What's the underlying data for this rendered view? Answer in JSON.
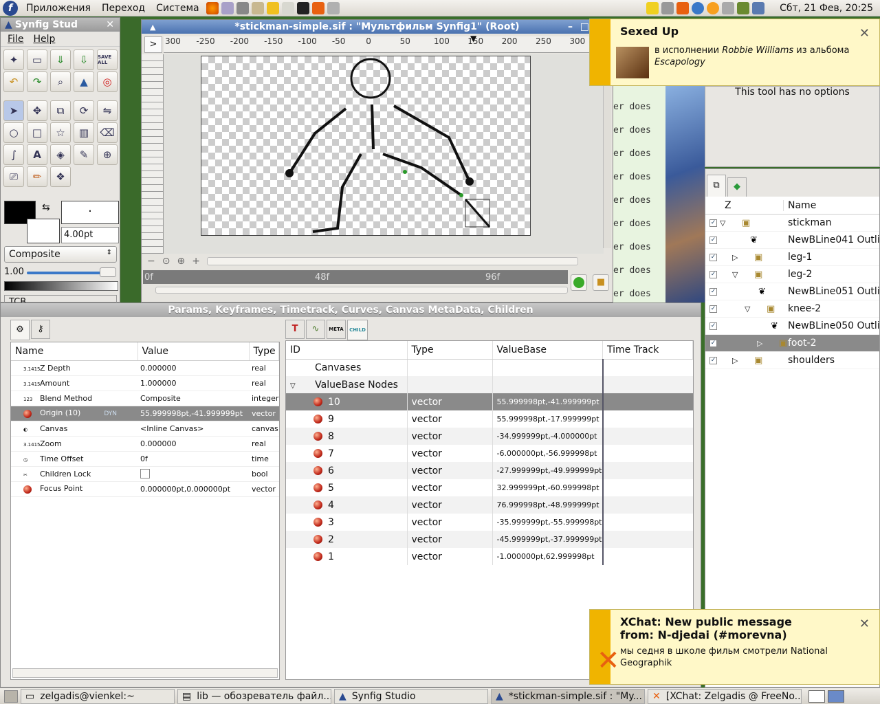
{
  "topbar": {
    "menus": [
      "Приложения",
      "Переход",
      "Система"
    ],
    "clock": "Сбт, 21 Фев, 20:25"
  },
  "toolbox": {
    "title": "Synfig Stud",
    "menu": [
      "File",
      "Help"
    ],
    "brush_size": "4.00pt",
    "blend": "Composite",
    "opacity": "1.00",
    "interp": "TCB"
  },
  "canvas": {
    "title": "*stickman-simple.sif : \"Мультфильм Synfig1\" (Root)",
    "hruler": [
      "300",
      "-250",
      "-200",
      "-150",
      "-100",
      "-50",
      "0",
      "50",
      "100",
      "150",
      "200",
      "250",
      "300"
    ],
    "timeline_marks": [
      "0f",
      "48f",
      "96f"
    ],
    "side_text": "er does"
  },
  "tool_options": {
    "text": "This tool has no options"
  },
  "params_panel": {
    "title": "Params, Keyframes, Timetrack, Curves, Canvas MetaData, Children",
    "columns": [
      "Name",
      "Value",
      "Type"
    ],
    "rows": [
      {
        "name": "Z Depth",
        "value": "0.000000",
        "type": "real"
      },
      {
        "name": "Amount",
        "value": "1.000000",
        "type": "real"
      },
      {
        "name": "Blend Method",
        "value": "Composite",
        "type": "integer"
      },
      {
        "name": "Origin (10)",
        "value": "55.999998pt,-41.999999pt",
        "type": "vector"
      },
      {
        "name": "Canvas",
        "value": "<Inline Canvas>",
        "type": "canvas"
      },
      {
        "name": "Zoom",
        "value": "0.000000",
        "type": "real"
      },
      {
        "name": "Time Offset",
        "value": "0f",
        "type": "time"
      },
      {
        "name": "Children Lock",
        "value": "",
        "type": "bool"
      },
      {
        "name": "Focus Point",
        "value": "0.000000pt,0.000000pt",
        "type": "vector"
      }
    ],
    "dyn": "DYN"
  },
  "children_panel": {
    "tab_meta": "META",
    "tab_child": "CHILD",
    "columns": [
      "ID",
      "Type",
      "ValueBase",
      "Time Track"
    ],
    "canvases": "Canvases",
    "valuebase_nodes": "ValueBase Nodes",
    "nodes": [
      {
        "id": "10",
        "type": "vector",
        "value": "55.999998pt,-41.999999pt"
      },
      {
        "id": "9",
        "type": "vector",
        "value": "55.999998pt,-17.999999pt"
      },
      {
        "id": "8",
        "type": "vector",
        "value": "-34.999999pt,-4.000000pt"
      },
      {
        "id": "7",
        "type": "vector",
        "value": "-6.000000pt,-56.999998pt"
      },
      {
        "id": "6",
        "type": "vector",
        "value": "-27.999999pt,-49.999999pt"
      },
      {
        "id": "5",
        "type": "vector",
        "value": "32.999999pt,-60.999998pt"
      },
      {
        "id": "4",
        "type": "vector",
        "value": "76.999998pt,-48.999999pt"
      },
      {
        "id": "3",
        "type": "vector",
        "value": "-35.999999pt,-55.999998pt"
      },
      {
        "id": "2",
        "type": "vector",
        "value": "-45.999999pt,-37.999999pt"
      },
      {
        "id": "1",
        "type": "vector",
        "value": "-1.000000pt,62.999998pt"
      }
    ]
  },
  "layers_panel": {
    "columns": [
      "Z",
      "Name"
    ],
    "layers": [
      {
        "name": "stickman",
        "indent": 0,
        "expander": "open",
        "kind": "group"
      },
      {
        "name": "NewBLine041 Outlin",
        "indent": 1,
        "expander": "",
        "kind": "outline"
      },
      {
        "name": "leg-1",
        "indent": 1,
        "expander": "closed",
        "kind": "group"
      },
      {
        "name": "leg-2",
        "indent": 1,
        "expander": "open",
        "kind": "group"
      },
      {
        "name": "NewBLine051 Outlin",
        "indent": 2,
        "expander": "",
        "kind": "outline"
      },
      {
        "name": "knee-2",
        "indent": 2,
        "expander": "open",
        "kind": "group"
      },
      {
        "name": "NewBLine050 Outlin",
        "indent": 3,
        "expander": "",
        "kind": "outline"
      },
      {
        "name": "foot-2",
        "indent": 3,
        "expander": "closed",
        "kind": "group",
        "selected": true
      },
      {
        "name": "shoulders",
        "indent": 1,
        "expander": "closed",
        "kind": "group"
      }
    ]
  },
  "notifications": [
    {
      "title": "Sexed Up",
      "line1": "в исполнении ",
      "artist": "Robbie Williams",
      "line2": " из альбома",
      "album": "Escapology"
    },
    {
      "title": "XChat: New public message from: N-djedai (#morevna)",
      "body": "мы седня в школе фильм смотрели National Geographik"
    }
  ],
  "taskbar": [
    {
      "label": "zelgadis@vienkel:~"
    },
    {
      "label": "lib — обозреватель файл..."
    },
    {
      "label": "Synfig Studio"
    },
    {
      "label": "*stickman-simple.sif : \"My..."
    },
    {
      "label": "[XChat: Zelgadis @ FreeNo..."
    }
  ],
  "colors": {
    "accent": "#4a72b0",
    "selected_row": "#8a8a8a",
    "notif_bg": "#fff8c8",
    "notif_bar": "#f0b400"
  }
}
